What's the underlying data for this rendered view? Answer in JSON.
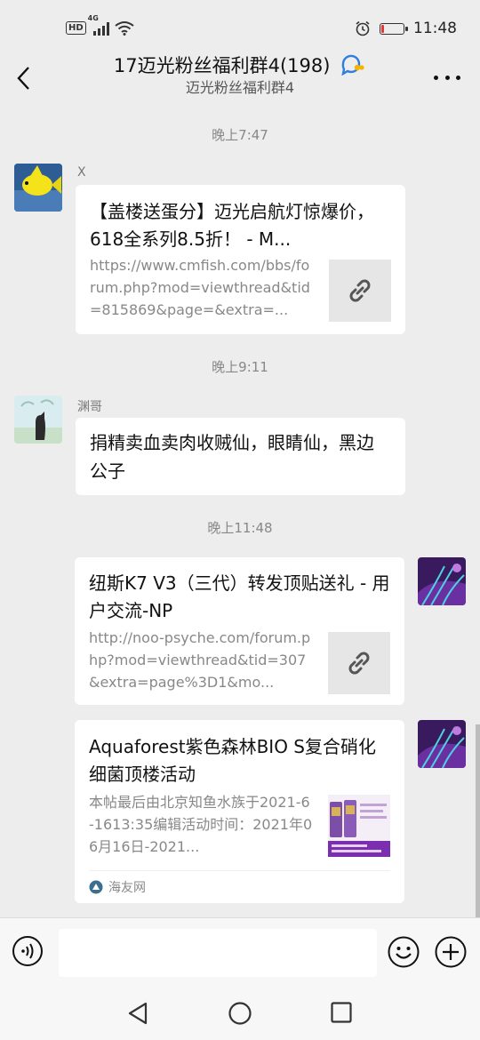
{
  "status_bar": {
    "network_badge": "HD",
    "network_type": "4G",
    "time": "11:48",
    "battery_level": 0.12
  },
  "header": {
    "title": "17迈光粉丝福利群4(198)",
    "subtitle": "迈光粉丝福利群4"
  },
  "messages": [
    {
      "time": "晚上7:47"
    },
    {
      "sender": "X",
      "type": "link",
      "title": "【盖楼送蛋分】迈光启航灯惊爆价，618全系列8.5折！ - M...",
      "desc": "https://www.cmfish.com/bbs/forum.php?mod=viewthread&tid=815869&page=&extra=..."
    },
    {
      "time": "晚上9:11"
    },
    {
      "sender": "渊哥",
      "type": "text",
      "text": "捐精卖血卖肉收贼仙，眼睛仙，黑边公子"
    },
    {
      "time": "晚上11:48"
    },
    {
      "sender": "self",
      "type": "link",
      "title": "纽斯K7 V3（三代）转发顶贴送礼 - 用户交流-NP",
      "desc": "http://noo-psyche.com/forum.php?mod=viewthread&tid=307&extra=page%3D1&mo..."
    },
    {
      "sender": "self",
      "type": "card",
      "title": "Aquaforest紫色森林BIO S复合硝化细菌顶楼活动",
      "desc": "本帖最后由北京知鱼水族于2021-6-1613:35编辑活动时间：2021年06月16日-2021...",
      "source": "海友网"
    }
  ],
  "input": {
    "placeholder": "",
    "value": ""
  },
  "icons": {
    "back": "back-arrow-icon",
    "more": "more-dots-icon",
    "voice": "voice-icon",
    "emoji": "emoji-icon",
    "plus": "plus-icon",
    "link": "link-icon"
  },
  "colors": {
    "background": "#ededed",
    "bubble": "#ffffff",
    "battery_low": "#e53935"
  }
}
